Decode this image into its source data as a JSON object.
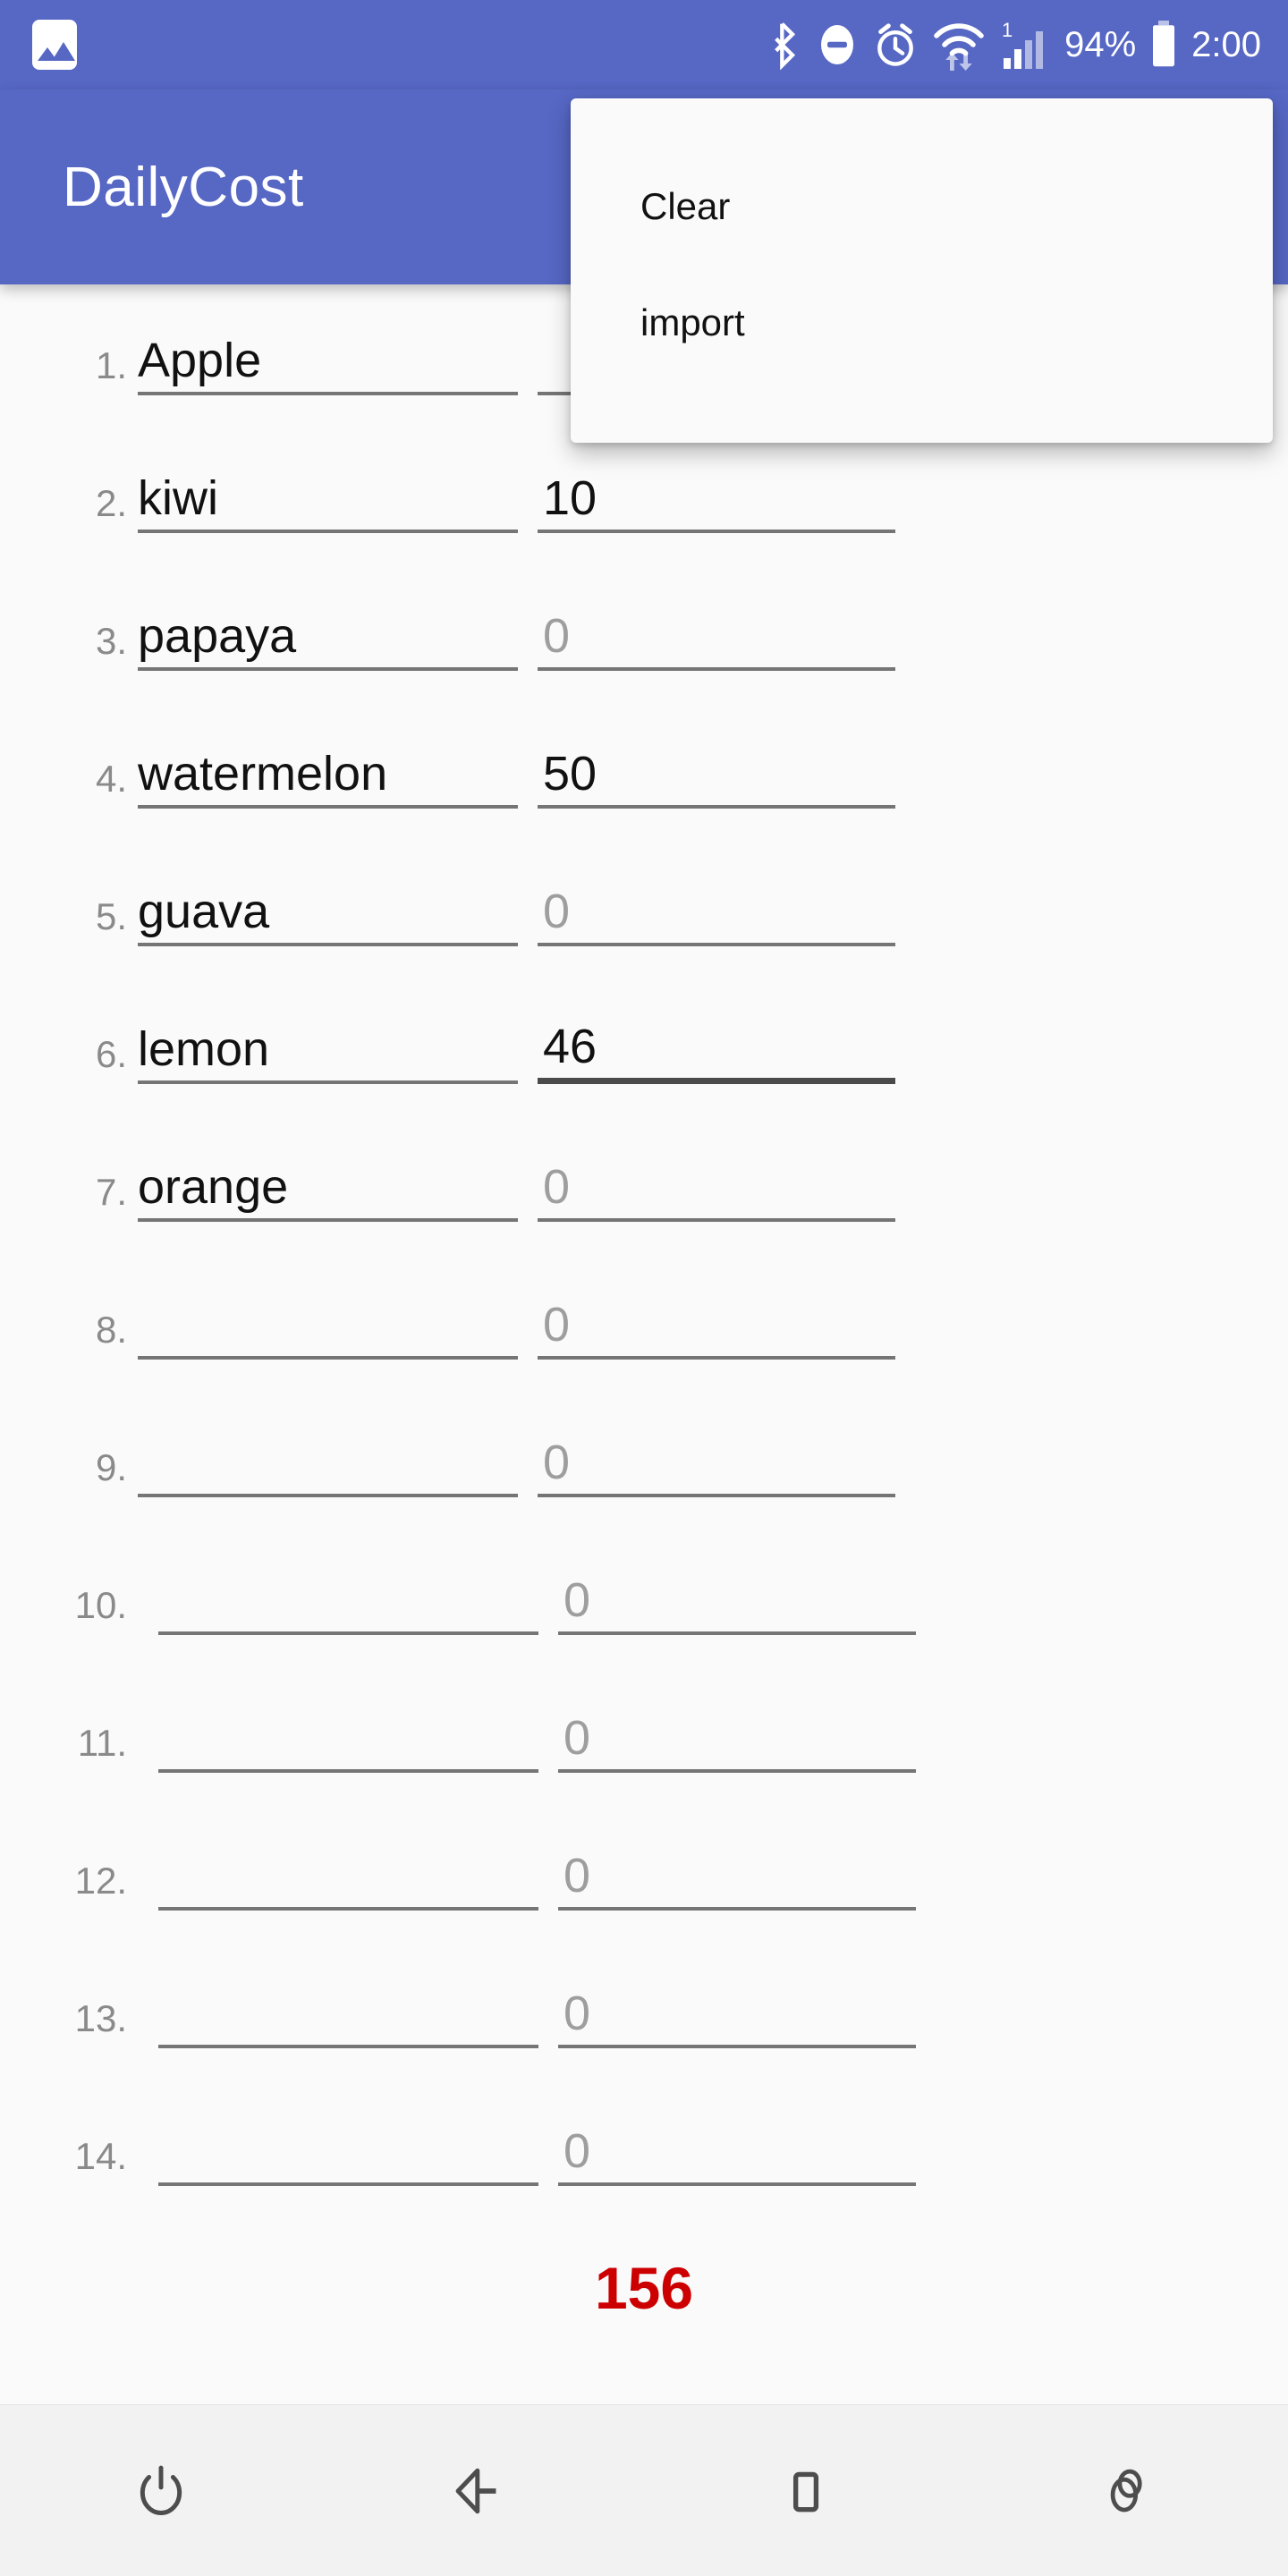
{
  "status_bar": {
    "notification_icon": "gallery-icon",
    "icons": [
      "bluetooth-icon",
      "do-not-disturb-icon",
      "alarm-clock-icon",
      "wifi-icon",
      "cellular-signal-icon"
    ],
    "sim_label": "1",
    "battery_percent": "94%",
    "battery_icon": "battery-icon",
    "clock": "2:00",
    "background_color": "#5667c4"
  },
  "app_bar": {
    "title": "DailyCost",
    "background_color": "#5667c4",
    "text_color": "#ffffff"
  },
  "overflow_menu": {
    "visible": true,
    "items": [
      {
        "label": "Clear"
      },
      {
        "label": "import"
      }
    ]
  },
  "list": {
    "value_placeholder": "0",
    "rows": [
      {
        "index": "1.",
        "name": "Apple",
        "value": "",
        "value_placeholder": "",
        "focused": false
      },
      {
        "index": "2.",
        "name": "kiwi",
        "value": "10",
        "value_placeholder": "0",
        "focused": false
      },
      {
        "index": "3.",
        "name": "papaya",
        "value": "",
        "value_placeholder": "0",
        "focused": false
      },
      {
        "index": "4.",
        "name": "watermelon",
        "value": "50",
        "value_placeholder": "0",
        "focused": false
      },
      {
        "index": "5.",
        "name": "guava",
        "value": "",
        "value_placeholder": "0",
        "focused": false
      },
      {
        "index": "6.",
        "name": "lemon",
        "value": "46",
        "value_placeholder": "0",
        "focused": true
      },
      {
        "index": "7.",
        "name": "orange",
        "value": "",
        "value_placeholder": "0",
        "focused": false
      },
      {
        "index": "8.",
        "name": "",
        "value": "",
        "value_placeholder": "0",
        "focused": false
      },
      {
        "index": "9.",
        "name": "",
        "value": "",
        "value_placeholder": "0",
        "focused": false
      },
      {
        "index": "10.",
        "name": "",
        "value": "",
        "value_placeholder": "0",
        "focused": false
      },
      {
        "index": "11.",
        "name": "",
        "value": "",
        "value_placeholder": "0",
        "focused": false
      },
      {
        "index": "12.",
        "name": "",
        "value": "",
        "value_placeholder": "0",
        "focused": false
      },
      {
        "index": "13.",
        "name": "",
        "value": "",
        "value_placeholder": "0",
        "focused": false
      },
      {
        "index": "14.",
        "name": "",
        "value": "",
        "value_placeholder": "0",
        "focused": false
      }
    ]
  },
  "total": {
    "value": "156",
    "color": "#cc0000"
  },
  "nav_bar": {
    "buttons": [
      {
        "name": "power-icon"
      },
      {
        "name": "back-icon"
      },
      {
        "name": "home-icon"
      },
      {
        "name": "recents-icon"
      }
    ]
  }
}
